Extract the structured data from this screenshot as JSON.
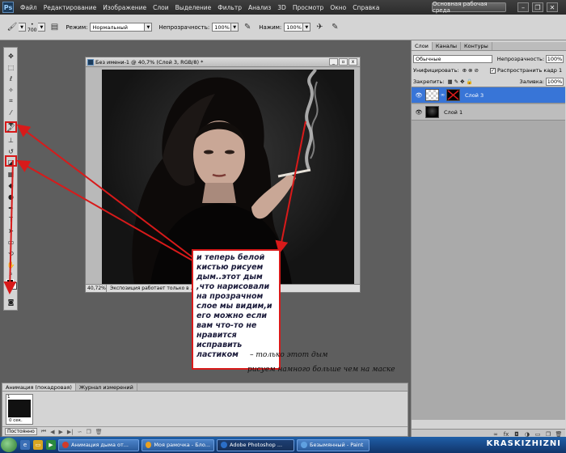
{
  "app_bar": {
    "logo": "Ps",
    "menu": [
      "Файл",
      "Редактирование",
      "Изображение",
      "Слои",
      "Выделение",
      "Фильтр",
      "Анализ",
      "3D",
      "Просмотр",
      "Окно",
      "Справка"
    ],
    "zoom": "40,7",
    "workspace": "Основная рабочая среда",
    "minimize": "–",
    "restore": "❐",
    "close": "✕"
  },
  "options_bar": {
    "brush_size": "700",
    "mode_label": "Режим:",
    "mode_value": "Нормальный",
    "opacity_label": "Непрозрачность:",
    "opacity_value": "100%",
    "flow_label": "Нажим:",
    "flow_value": "100%"
  },
  "document": {
    "title": "Без имени-1 @ 40,7% (Слой 3, RGB/8) *",
    "zoom": "40,72%",
    "status": "Экспозиция работает только в ...",
    "minimize": "_",
    "restore": "▫",
    "close": "x"
  },
  "callout": {
    "text": "и теперь белой\nкистью рисуем\nдым..этот дым\n,что нарисовали\nна прозрачном\nслое мы видим,и\nего можно если\nвам что-то не\nнравится\nисправить\nластиком"
  },
  "handwritten_notes": {
    "line1": "– только этот дым",
    "line2": "рисуем намного больше чем на маске"
  },
  "layers_panel": {
    "tabs": [
      "Слои",
      "Каналы",
      "Контуры"
    ],
    "blend_mode": "Обычные",
    "opacity_label": "Непрозрачность:",
    "opacity_value": "100%",
    "unify_label": "Унифицировать:",
    "propagate_label": "Распространить кадр 1",
    "lock_label": "Закрепить:",
    "fill_label": "Заливка:",
    "fill_value": "100%",
    "layers": [
      {
        "name": "Слой 3",
        "selected": true
      },
      {
        "name": "Слой 1",
        "selected": false
      }
    ]
  },
  "animation_panel": {
    "tabs": [
      "Анимация (покадровая)",
      "Журнал измерений"
    ],
    "frame_number": "1",
    "frame_delay": "0 сек.",
    "loop": "Постоянно"
  },
  "taskbar": {
    "tasks": [
      {
        "label": "Анимация дыма от...",
        "active": false,
        "color": "#d03b2b"
      },
      {
        "label": "Моя рамочка - Бло...",
        "active": false,
        "color": "#e8a020"
      },
      {
        "label": "Adobe Photoshop ...",
        "active": true,
        "color": "#2b6fc8"
      },
      {
        "label": "Безымянный - Paint",
        "active": false,
        "color": "#5fa0e0"
      }
    ],
    "watermark": "KRASKIZHIZNI"
  },
  "colors": {
    "accent_red": "#d81a1a",
    "selected_layer": "#3875d7"
  }
}
